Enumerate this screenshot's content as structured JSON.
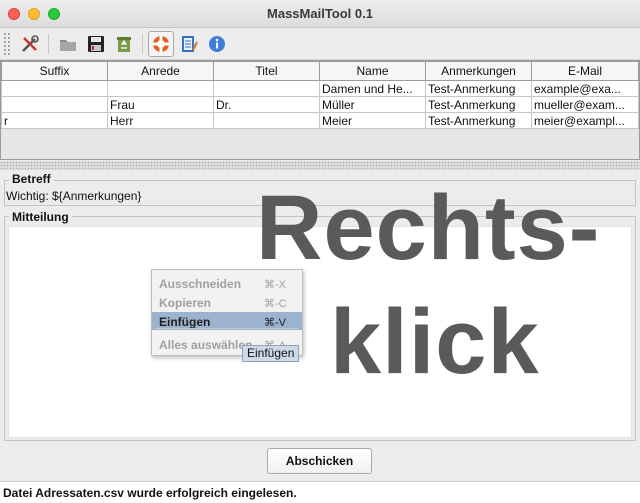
{
  "window": {
    "title": "MassMailTool 0.1"
  },
  "toolbar": {
    "icons": [
      "tools-icon",
      "folder-icon",
      "save-icon",
      "recycle-icon",
      "lifebuoy-icon",
      "edit-list-icon",
      "info-icon"
    ]
  },
  "table": {
    "headers": [
      "Suffix",
      "Anrede",
      "Titel",
      "Name",
      "Anmerkungen",
      "E-Mail"
    ],
    "rows": [
      [
        "",
        "",
        "",
        "Damen und He...",
        "Test-Anmerkung",
        "example@exa..."
      ],
      [
        "",
        "Frau",
        "Dr.",
        "Müller",
        "Test-Anmerkung",
        "mueller@exam..."
      ],
      [
        "r",
        "Herr",
        "",
        "Meier",
        "Test-Anmerkung",
        "meier@exampl..."
      ]
    ]
  },
  "betreff": {
    "legend": "Betreff",
    "value": "Wichtig: ${Anmerkungen}"
  },
  "mitteilung": {
    "legend": "Mitteilung",
    "value": ""
  },
  "overlay": {
    "line1": "Rechts-",
    "line2": "klick"
  },
  "context_menu": {
    "items": [
      {
        "label": "Ausschneiden",
        "shortcut": "⌘-X",
        "enabled": false
      },
      {
        "label": "Kopieren",
        "shortcut": "⌘-C",
        "enabled": false
      },
      {
        "label": "Einfügen",
        "shortcut": "⌘-V",
        "enabled": true,
        "selected": true
      },
      {
        "label": "Alles auswählen",
        "shortcut": "⌘-A",
        "enabled": false
      }
    ],
    "tooltip": "Einfügen"
  },
  "send_button": {
    "label": "Abschicken"
  },
  "status": {
    "text": "Datei Adressaten.csv wurde erfolgreich eingelesen."
  },
  "colors": {
    "selected": "#9bb3cf",
    "overlay": "#5a5a5a"
  }
}
